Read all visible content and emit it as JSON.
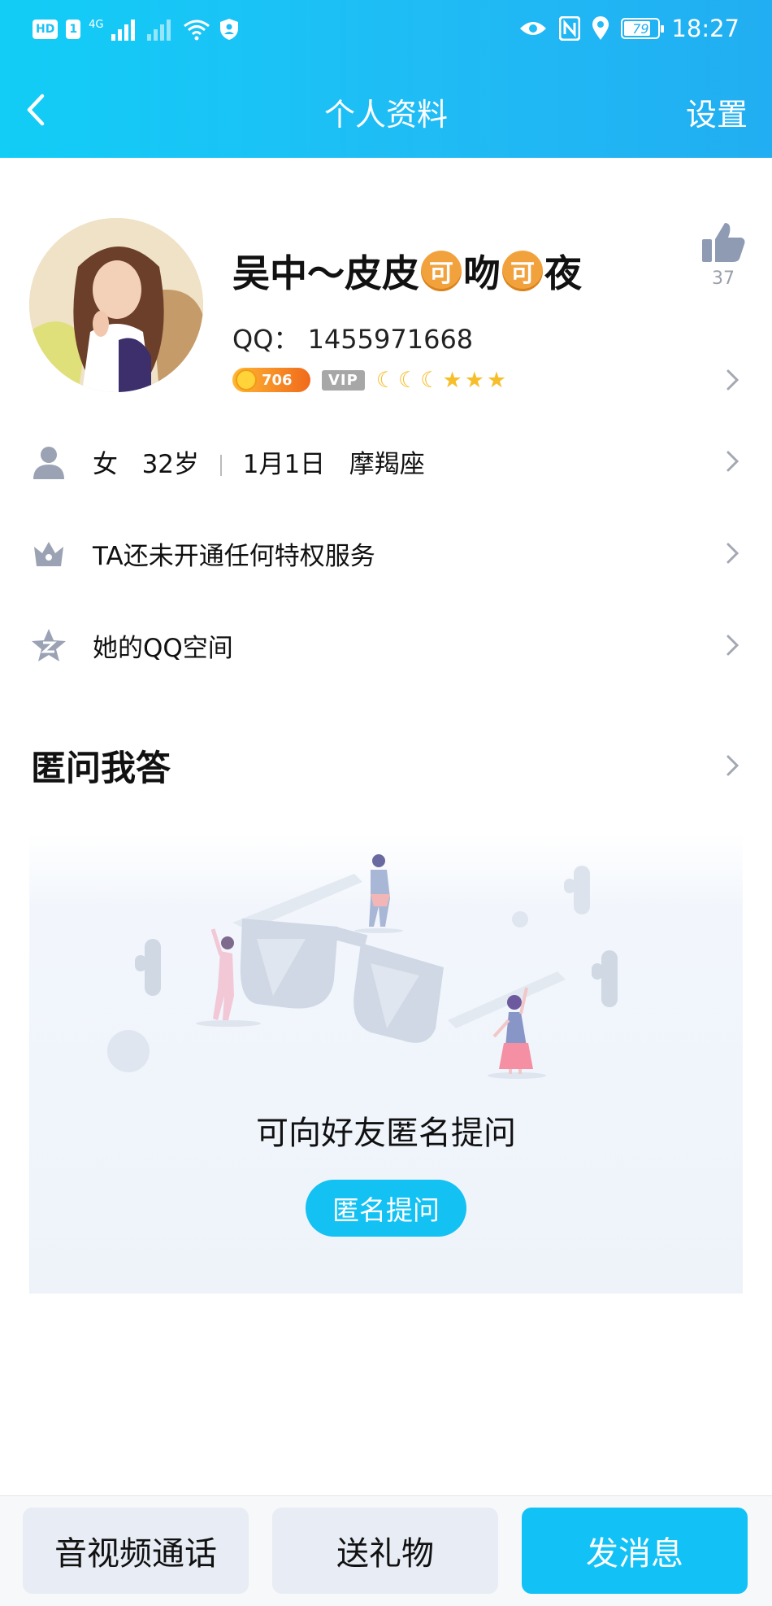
{
  "status_bar": {
    "left_badges": [
      "HD",
      "1"
    ],
    "network": "4G",
    "battery": "79",
    "time": "18:27"
  },
  "nav": {
    "title": "个人资料",
    "settings_label": "设置"
  },
  "profile": {
    "name_parts": [
      "吴中～皮皮",
      "可",
      "吻",
      "可",
      "夜"
    ],
    "qq_label": "QQ：",
    "qq_number": "1455971668",
    "coin_value": "706",
    "vip_label": "VIP",
    "like_count": "37"
  },
  "info_rows": {
    "gender": "女",
    "age": "32岁",
    "birthday": "1月1日",
    "zodiac": "摩羯座",
    "privilege": "TA还未开通任何特权服务",
    "qzone": "她的QQ空间"
  },
  "qa": {
    "title": "匿问我答",
    "prompt": "可向好友匿名提问",
    "button_label": "匿名提问"
  },
  "bottom_bar": {
    "call_label": "音视频通话",
    "gift_label": "送礼物",
    "message_label": "发消息"
  },
  "colors": {
    "header_start": "#12cdf6",
    "header_end": "#21aef2",
    "accent": "#13c1f3"
  }
}
